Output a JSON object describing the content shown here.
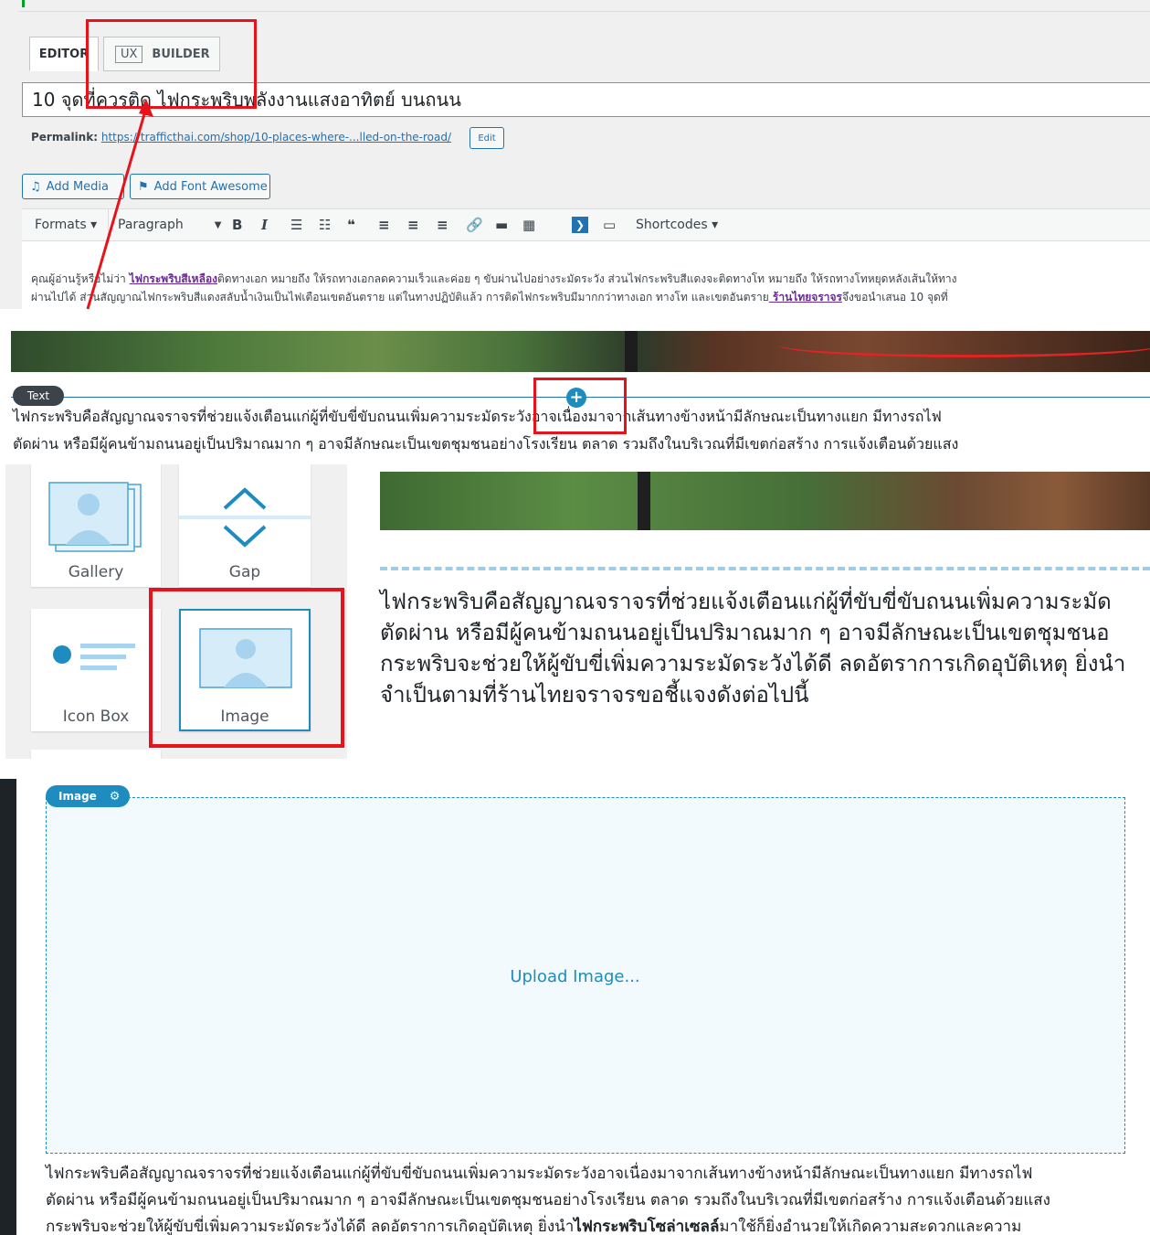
{
  "editor_panel": {
    "tabs": {
      "editor": "EDITOR",
      "ux_badge": "UX",
      "builder": "BUILDER"
    },
    "title_value": "10 จุดที่ควรติด ไฟกระพริบพลังงานแสงอาทิตย์ บนถนน",
    "permalink": {
      "label": "Permalink:",
      "url": "https://trafficthai.com/shop/10-places-where-...lled-on-the-road/",
      "edit_label": "Edit"
    },
    "media_buttons": {
      "add_media": "Add Media",
      "add_font_awesome": "Add Font Awesome"
    },
    "toolbar": {
      "formats": "Formats ▾",
      "paragraph": "Paragraph",
      "shortcodes": "Shortcodes ▾"
    },
    "content": {
      "line1_a": "คุณผู้อ่านรู้หรือไม่ว่า ",
      "line1_link": "ไฟกระพริบสีเหลือง",
      "line1_b": "ติดทางเอก หมายถึง ให้รถทางเอกลดความเร็วและค่อย ๆ ขับผ่านไปอย่างระมัดระวัง ส่วนไฟกระพริบสีแดงจะติดทางโท หมายถึง ให้รถทางโทหยุดหลังเส้นให้ทาง",
      "line2_a": "ผ่านไปได้ ส่วนสัญญาณไฟกระพริบสีแดงสลับน้ำเงินเป็นไฟเตือนเขตอันตราย แต่ในทางปฏิบัติแล้ว การติดไฟกระพริบมีมากกว่าทางเอก ทางโท และเขตอันตราย",
      "line2_link": " ร้านไทยจราจร",
      "line2_b": "จึงขอนำเสนอ 10 จุดที่"
    }
  },
  "builder_text_panel": {
    "badge": "Text",
    "line1": "ไฟกระพริบคือสัญญาณจราจรที่ช่วยแจ้งเตือนแก่ผู้ที่ขับขี่ขับถนนเพิ่มความระมัดระวังอาจเนื่องมาจากเส้นทางข้างหน้ามีลักษณะเป็นทางแยก มีทางรถไฟ",
    "line2": "ตัดผ่าน หรือมีผู้คนข้ามถนนอยู่เป็นปริมาณมาก ๆ อาจมีลักษณะเป็นเขตชุมชนอย่างโรงเรียน ตลาด รวมถึงในบริเวณที่มีเขตก่อสร้าง การแจ้งเตือนด้วยแสง"
  },
  "element_picker": {
    "items": [
      {
        "label": "Gallery"
      },
      {
        "label": "Gap"
      },
      {
        "label": "Icon Box"
      },
      {
        "label": "Image"
      }
    ],
    "preview_lines": [
      "ไฟกระพริบคือสัญญาณจราจรที่ช่วยแจ้งเตือนแก่ผู้ที่ขับขี่ขับถนนเพิ่มความระมัด",
      "ตัดผ่าน หรือมีผู้คนข้ามถนนอยู่เป็นปริมาณมาก ๆ อาจมีลักษณะเป็นเขตชุมชนอ",
      "กระพริบจะช่วยให้ผู้ขับขี่เพิ่มความระมัดระวังได้ดี ลดอัตราการเกิดอุบัติเหตุ ยิ่งนำ",
      "จำเป็นตามที่ร้านไทยจราจรขอชี้แจงดังต่อไปนี้"
    ]
  },
  "image_panel": {
    "badge": "Image",
    "upload_label": "Upload Image...",
    "line1": "ไฟกระพริบคือสัญญาณจราจรที่ช่วยแจ้งเตือนแก่ผู้ที่ขับขี่ขับถนนเพิ่มความระมัดระวังอาจเนื่องมาจากเส้นทางข้างหน้ามีลักษณะเป็นทางแยก มีทางรถไฟ",
    "line2": "ตัดผ่าน หรือมีผู้คนข้ามถนนอยู่เป็นปริมาณมาก ๆ อาจมีลักษณะเป็นเขตชุมชนอย่างโรงเรียน ตลาด รวมถึงในบริเวณที่มีเขตก่อสร้าง การแจ้งเตือนด้วยแสง",
    "line3_a": "กระพริบจะช่วยให้ผู้ขับขี่เพิ่มความระมัดระวังได้ดี ลดอัตราการเกิดอุบัติเหตุ ยิ่งนำ",
    "line3_bold": "ไฟกระพริบโซล่าเซลล์",
    "line3_b": "มาใช้ก็ยิ่งอำนวยให้เกิดความสะดวกและความ"
  },
  "colors": {
    "highlight": "#e8121b",
    "accent": "#1e8cbe",
    "wp_link": "#2271b1"
  }
}
